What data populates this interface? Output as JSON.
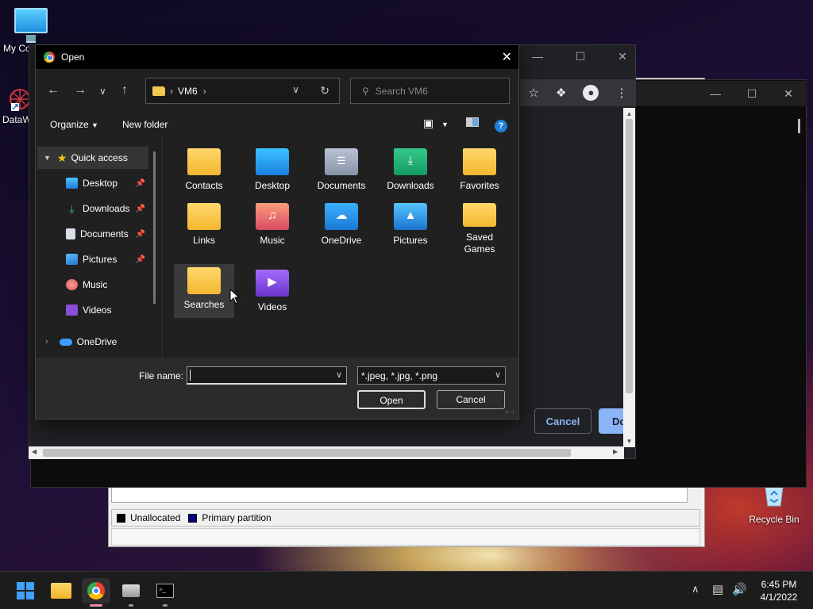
{
  "desktop": {
    "icons": [
      {
        "label": "My Co"
      },
      {
        "label": "DataW"
      },
      {
        "label": "Recycle Bin"
      }
    ]
  },
  "disk_mgmt": {
    "legend": [
      "Unallocated",
      "Primary partition"
    ],
    "colors": {
      "unallocated": "#000000",
      "primary": "#000080"
    }
  },
  "chrome": {
    "buttons": {
      "cancel": "Cancel",
      "done": "Do"
    },
    "accent": "#8ab4f8"
  },
  "dialog": {
    "title": "Open",
    "address": {
      "folder": "VM6"
    },
    "search_placeholder": "Search VM6",
    "toolbar": {
      "organize": "Organize",
      "new_folder": "New folder",
      "help": "?"
    },
    "nav": {
      "quick_access": "Quick access",
      "items": [
        {
          "label": "Desktop",
          "pinned": true
        },
        {
          "label": "Downloads",
          "pinned": true
        },
        {
          "label": "Documents",
          "pinned": true
        },
        {
          "label": "Pictures",
          "pinned": true
        },
        {
          "label": "Music",
          "pinned": false
        },
        {
          "label": "Videos",
          "pinned": false
        }
      ],
      "onedrive": "OneDrive"
    },
    "files": [
      {
        "label": "Contacts",
        "icon": "folder-icon"
      },
      {
        "label": "Desktop",
        "icon": "desktop-folder-icon"
      },
      {
        "label": "Documents",
        "icon": "documents-folder-icon"
      },
      {
        "label": "Downloads",
        "icon": "downloads-folder-icon"
      },
      {
        "label": "Favorites",
        "icon": "folder-icon"
      },
      {
        "label": "Links",
        "icon": "folder-icon"
      },
      {
        "label": "Music",
        "icon": "music-folder-icon"
      },
      {
        "label": "OneDrive",
        "icon": "onedrive-folder-icon"
      },
      {
        "label": "Pictures",
        "icon": "pictures-folder-icon"
      },
      {
        "label": "Saved Games",
        "icon": "folder-icon"
      },
      {
        "label": "Searches",
        "icon": "folder-icon",
        "selected": true
      },
      {
        "label": "Videos",
        "icon": "videos-folder-icon"
      }
    ],
    "file_name_label": "File name:",
    "file_name_value": "",
    "file_type": "*.jpeg, *.jpg, *.png",
    "open_button": "Open",
    "cancel_button": "Cancel"
  },
  "taskbar": {
    "clock_time": "6:45 PM",
    "clock_date": "4/1/2022"
  }
}
